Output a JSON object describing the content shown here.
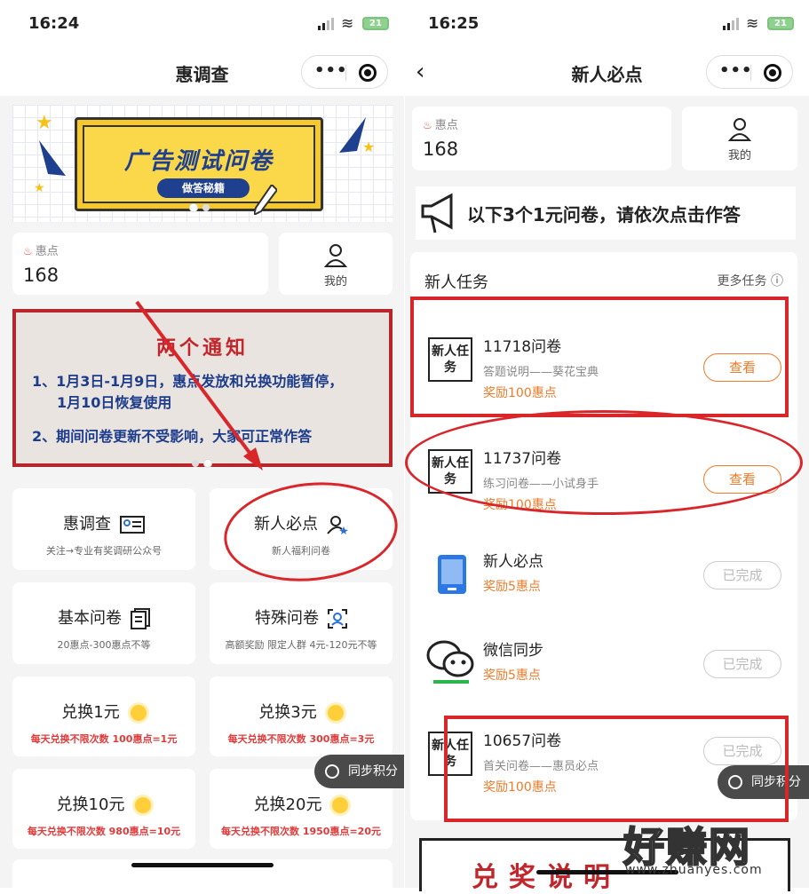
{
  "left": {
    "status": {
      "time": "16:24",
      "battery": "21"
    },
    "nav": {
      "title": "惠调查"
    },
    "banner": {
      "title": "广告测试问卷",
      "subtitle": "做答秘籍"
    },
    "points": {
      "label": "惠点",
      "value": "168"
    },
    "me": {
      "label": "我的"
    },
    "notice": {
      "title": "两个通知",
      "line1": "1、1月3日-1月9日，惠点发放和兑换功能暂停，",
      "line1b": "1月10日恢复使用",
      "line2": "2、期间问卷更新不受影响，大家可正常作答"
    },
    "grid": [
      {
        "title": "惠调查",
        "sub": "关注→专业有奖调研公众号",
        "icon": "id-card-icon"
      },
      {
        "title": "新人必点",
        "sub": "新人福利问卷",
        "icon": "user-star-icon"
      },
      {
        "title": "基本问卷",
        "sub": "20惠点-300惠点不等",
        "icon": "document-icon"
      },
      {
        "title": "特殊问卷",
        "sub": "高额奖励 限定人群 4元-120元不等",
        "icon": "face-scan-icon"
      },
      {
        "title": "兑换1元",
        "sub": "每天兑换不限次数 100惠点=1元",
        "icon": "sun-icon"
      },
      {
        "title": "兑换3元",
        "sub": "每天兑换不限次数 300惠点=3元",
        "icon": "sun-icon"
      },
      {
        "title": "兑换10元",
        "sub": "每天兑换不限次数 980惠点=10元",
        "icon": "sun-icon"
      },
      {
        "title": "兑换20元",
        "sub": "每天兑换不限次数 1950惠点=20元",
        "icon": "sun-icon"
      }
    ],
    "sync": "同步积分"
  },
  "right": {
    "status": {
      "time": "16:25",
      "battery": "21"
    },
    "nav": {
      "title": "新人必点"
    },
    "points": {
      "label": "惠点",
      "value": "168"
    },
    "me": {
      "label": "我的"
    },
    "announcement": "以下3个1元问卷，请依次点击作答",
    "panel": {
      "title": "新人任务",
      "more": "更多任务",
      "tasks": [
        {
          "name": "11718问卷",
          "desc": "答题说明——葵花宝典",
          "reward": "奖励100惠点",
          "button": "查看",
          "state": "view"
        },
        {
          "name": "11737问卷",
          "desc": "练习问卷——小试身手",
          "reward": "奖励100惠点",
          "button": "查看",
          "state": "view"
        },
        {
          "name": "新人必点",
          "desc": "",
          "reward": "奖励5惠点",
          "button": "已完成",
          "state": "done"
        },
        {
          "name": "微信同步",
          "desc": "",
          "reward": "奖励5惠点",
          "button": "已完成",
          "state": "done"
        },
        {
          "name": "10657问卷",
          "desc": "首关问卷——惠员必点",
          "reward": "奖励100惠点",
          "button": "已完成",
          "state": "done"
        }
      ],
      "new_badge": "新人任务"
    },
    "sync": "同步积分",
    "bottom_title": "兑奖说明"
  },
  "watermark": {
    "main": "好赚网",
    "url": "www.zhuanyes.com"
  },
  "colors": {
    "accent_orange": "#f07a28",
    "annotation_red": "#d9262b",
    "notice_blue": "#1d3c8c"
  }
}
